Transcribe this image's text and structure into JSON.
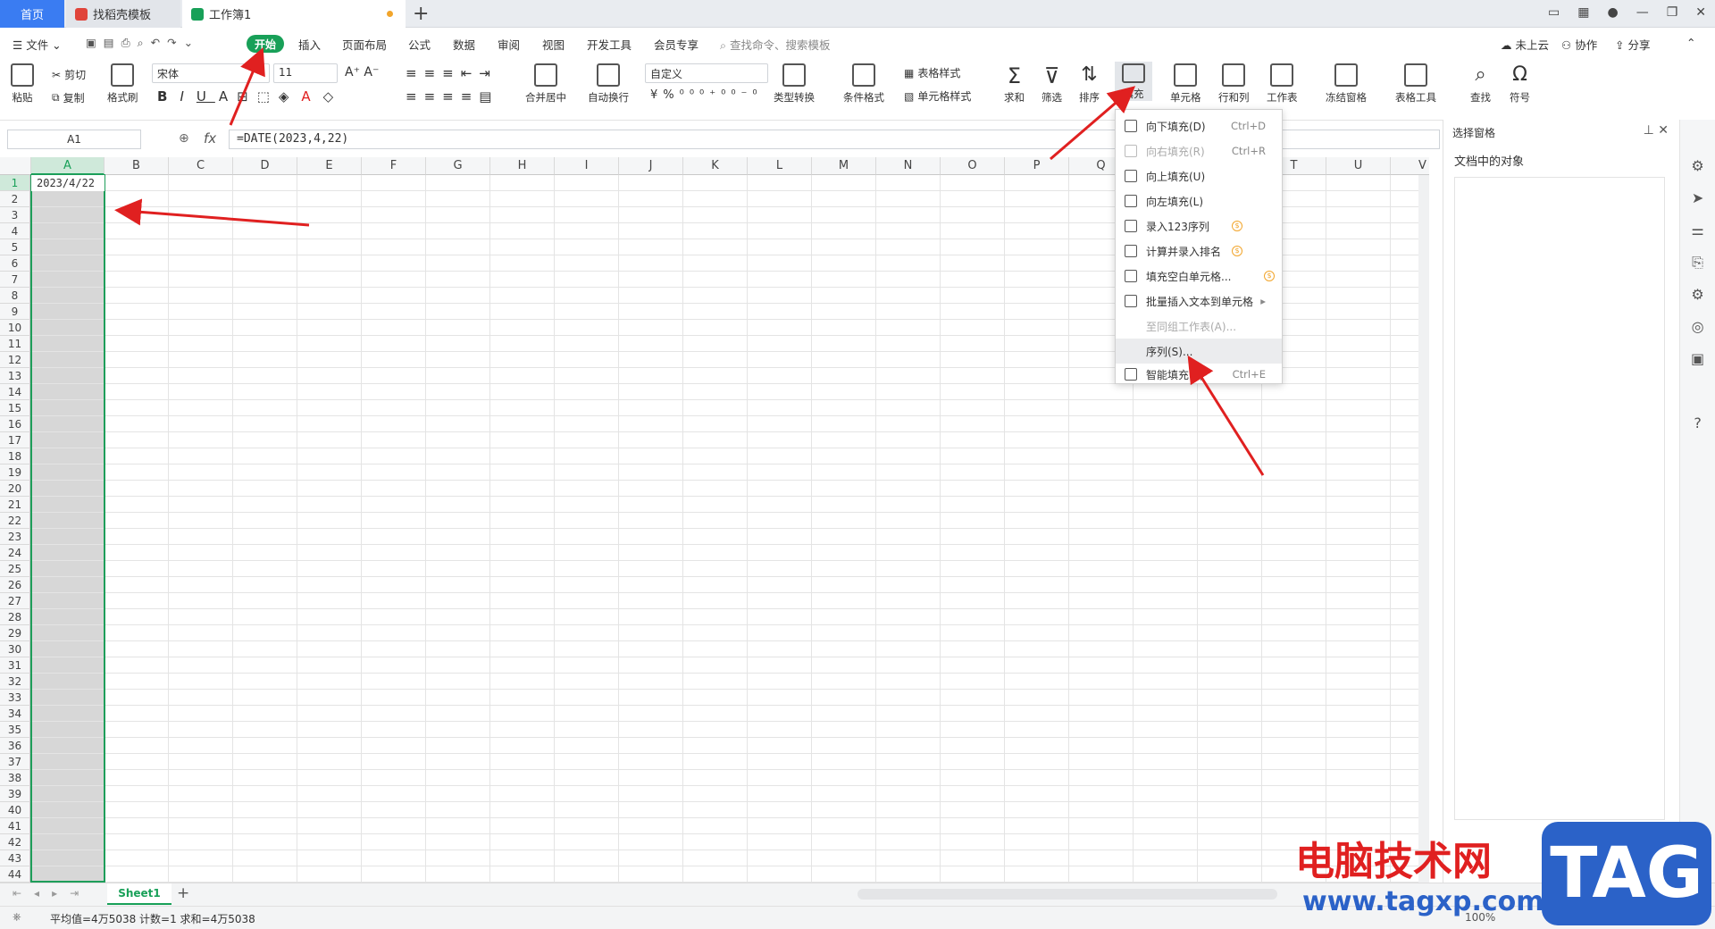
{
  "tabs": [
    {
      "label": "首页"
    },
    {
      "label": "找稻壳模板"
    },
    {
      "label": "工作簿1"
    }
  ],
  "menu": {
    "file": "文件",
    "items": [
      "开始",
      "插入",
      "页面布局",
      "公式",
      "数据",
      "审阅",
      "视图",
      "开发工具",
      "会员专享"
    ],
    "search": "查找命令、搜索模板",
    "right": [
      "未上云",
      "协作",
      "分享"
    ]
  },
  "ribbon": {
    "paste": "粘贴",
    "cut": "剪切",
    "copy": "复制",
    "format_painter": "格式刷",
    "font": "宋体",
    "size": "11",
    "merge": "合并居中",
    "wrap": "自动换行",
    "numfmt": "自定义",
    "convert": "类型转换",
    "cond": "条件格式",
    "table_style": "表格样式",
    "cell_style": "单元格样式",
    "sum": "求和",
    "filter": "筛选",
    "sort": "排序",
    "fill": "填充",
    "cells": "单元格",
    "rowcol": "行和列",
    "sheet": "工作表",
    "freeze": "冻结窗格",
    "tools": "表格工具",
    "find": "查找",
    "symbol": "符号"
  },
  "formula_bar": {
    "name": "A1",
    "fx": "fx",
    "formula": "=DATE(2023,4,22)"
  },
  "grid": {
    "columns": [
      "A",
      "B",
      "C",
      "D",
      "E",
      "F",
      "G",
      "H",
      "I",
      "J",
      "K",
      "L",
      "M",
      "N",
      "O",
      "P",
      "Q",
      "R",
      "S",
      "T",
      "U",
      "V"
    ],
    "rows": 44,
    "a1": "2023/4/22"
  },
  "fill_menu": [
    {
      "label": "向下填充(D)",
      "key": "Ctrl+D",
      "disabled": false
    },
    {
      "label": "向右填充(R)",
      "key": "Ctrl+R",
      "disabled": true
    },
    {
      "label": "向上填充(U)",
      "key": "",
      "disabled": false
    },
    {
      "label": "向左填充(L)",
      "key": "",
      "disabled": false
    },
    {
      "label": "录入123序列",
      "key": "",
      "disabled": false,
      "coin": true
    },
    {
      "label": "计算并录入排名",
      "key": "",
      "disabled": false,
      "coin": true
    },
    {
      "label": "填充空白单元格...",
      "key": "",
      "disabled": false,
      "coin": true
    },
    {
      "label": "批量插入文本到单元格",
      "key": "",
      "disabled": false,
      "submenu": true
    },
    {
      "label": "至同组工作表(A)...",
      "key": "",
      "disabled": true
    },
    {
      "label": "序列(S)...",
      "key": "",
      "disabled": false,
      "highlight": true
    },
    {
      "label": "智能填充(F)",
      "key": "Ctrl+E",
      "disabled": false
    }
  ],
  "right_panel": {
    "title": "选择窗格",
    "subtitle": "文档中的对象"
  },
  "sheet": {
    "name": "Sheet1"
  },
  "status": {
    "text": "平均值=4万5038  计数=1  求和=4万5038",
    "zoom": "100%"
  },
  "watermark": {
    "cn": "电脑技术网",
    "url": "www.tagxp.com",
    "logo": "TAG"
  },
  "colors": {
    "accent": "#18a058",
    "arrow": "#e02020",
    "tab_home": "#3a7cf2"
  }
}
